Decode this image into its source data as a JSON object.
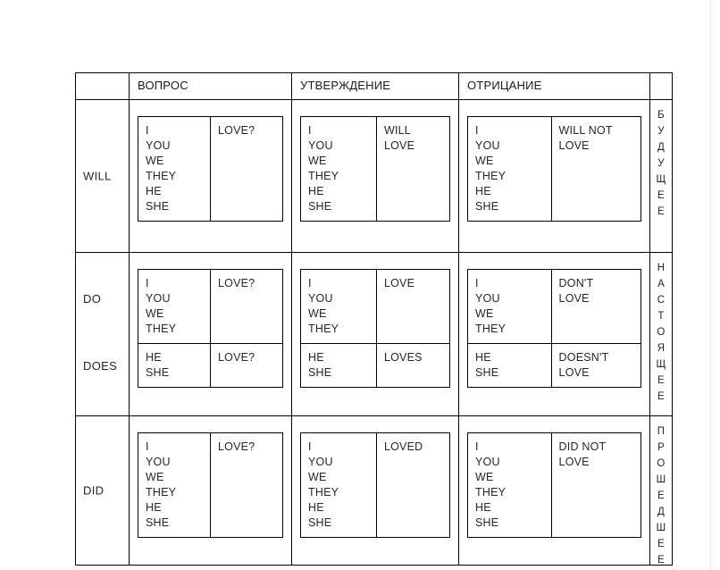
{
  "table": {
    "headers": {
      "corner": "",
      "question": "ВОПРОС",
      "affirmative": "УТВЕРЖДЕНИЕ",
      "negative": "ОТРИЦАНИЕ",
      "time": ""
    },
    "rows": [
      {
        "aux_primary": "WILL",
        "aux_secondary": "",
        "time_label": "БУДУЩЕЕ",
        "time_letters": [
          "Б",
          "У",
          "Д",
          "У",
          "Щ",
          "Е",
          "Е"
        ],
        "question": {
          "subjects": [
            "I",
            "YOU",
            "WE",
            "THEY",
            "HE",
            "SHE"
          ],
          "predicate": [
            "LOVE?"
          ]
        },
        "affirmative": {
          "subjects": [
            "I",
            "YOU",
            "WE",
            "THEY",
            "HE",
            "SHE"
          ],
          "predicate": [
            "WILL",
            "LOVE"
          ]
        },
        "negative": {
          "subjects": [
            "I",
            "YOU",
            "WE",
            "THEY",
            "HE",
            "SHE"
          ],
          "predicate": [
            "WILL NOT",
            "LOVE"
          ]
        }
      },
      {
        "aux_primary": "DO",
        "aux_secondary": "DOES",
        "time_label": "НАСТОЯЩЕЕ",
        "time_letters": [
          "Н",
          "А",
          "С",
          "Т",
          "О",
          "Я",
          "Щ",
          "Е",
          "Е"
        ],
        "question": {
          "top_subjects": [
            "I",
            "YOU",
            "WE",
            "THEY"
          ],
          "top_predicate": [
            "LOVE?"
          ],
          "bottom_subjects": [
            "HE",
            "SHE"
          ],
          "bottom_predicate": [
            "LOVE?"
          ]
        },
        "affirmative": {
          "top_subjects": [
            "I",
            "YOU",
            "WE",
            "THEY"
          ],
          "top_predicate": [
            "LOVE"
          ],
          "bottom_subjects": [
            "HE",
            "SHE"
          ],
          "bottom_predicate": [
            "LOVES"
          ]
        },
        "negative": {
          "top_subjects": [
            "I",
            "YOU",
            "WE",
            "THEY"
          ],
          "top_predicate": [
            "DON'T",
            "LOVE"
          ],
          "bottom_subjects": [
            "HE",
            "SHE"
          ],
          "bottom_predicate": [
            "DOESN'T",
            "LOVE"
          ]
        }
      },
      {
        "aux_primary": "DID",
        "aux_secondary": "",
        "time_label": "ПРОШЕДШЕЕ",
        "time_letters": [
          "П",
          "Р",
          "О",
          "Ш",
          "Е",
          "Д",
          "Ш",
          "Е",
          "Е"
        ],
        "question": {
          "subjects": [
            "I",
            "YOU",
            "WE",
            "THEY",
            "HE",
            "SHE"
          ],
          "predicate": [
            "LOVE?"
          ]
        },
        "affirmative": {
          "subjects": [
            "I",
            "YOU",
            "WE",
            "THEY",
            "HE",
            "SHE"
          ],
          "predicate": [
            "LOVED"
          ]
        },
        "negative": {
          "subjects": [
            "I",
            "YOU",
            "WE",
            "THEY",
            "HE",
            "SHE"
          ],
          "predicate": [
            "DID NOT",
            "LOVE"
          ]
        }
      }
    ]
  },
  "colors": {
    "border": "#000000",
    "text": "#262626",
    "background": "#ffffff"
  }
}
